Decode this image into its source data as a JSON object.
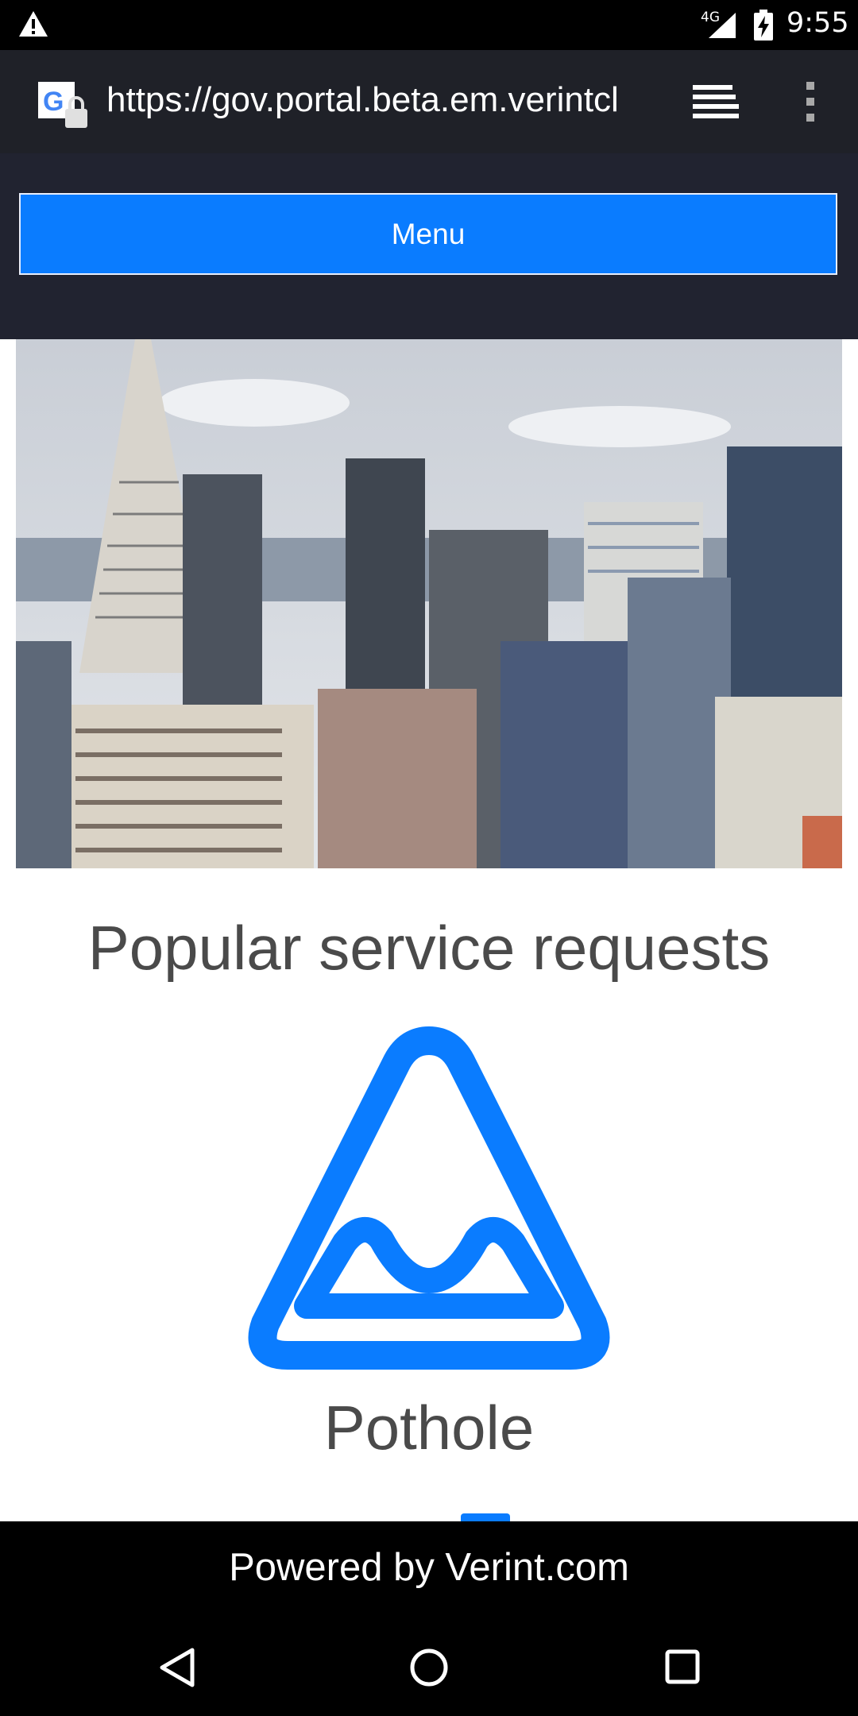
{
  "status_bar": {
    "network_type": "4G",
    "time": "9:55",
    "icons": [
      "warning-icon",
      "signal-icon",
      "battery-charging-icon"
    ]
  },
  "browser": {
    "url": "https://gov.portal.beta.em.verintcl",
    "icons": [
      "google-secure-icon",
      "tabs-icon",
      "overflow-menu-icon"
    ]
  },
  "page": {
    "menu_label": "Menu",
    "section_title": "Popular service requests",
    "service_item_label": "Pothole",
    "service_item_icon": "pothole-icon",
    "accent_color": "#0a7cff"
  },
  "footer": {
    "powered_by": "Powered by Verint.com"
  },
  "nav_bar": {
    "icons": [
      "back-icon",
      "home-icon",
      "recents-icon"
    ]
  }
}
